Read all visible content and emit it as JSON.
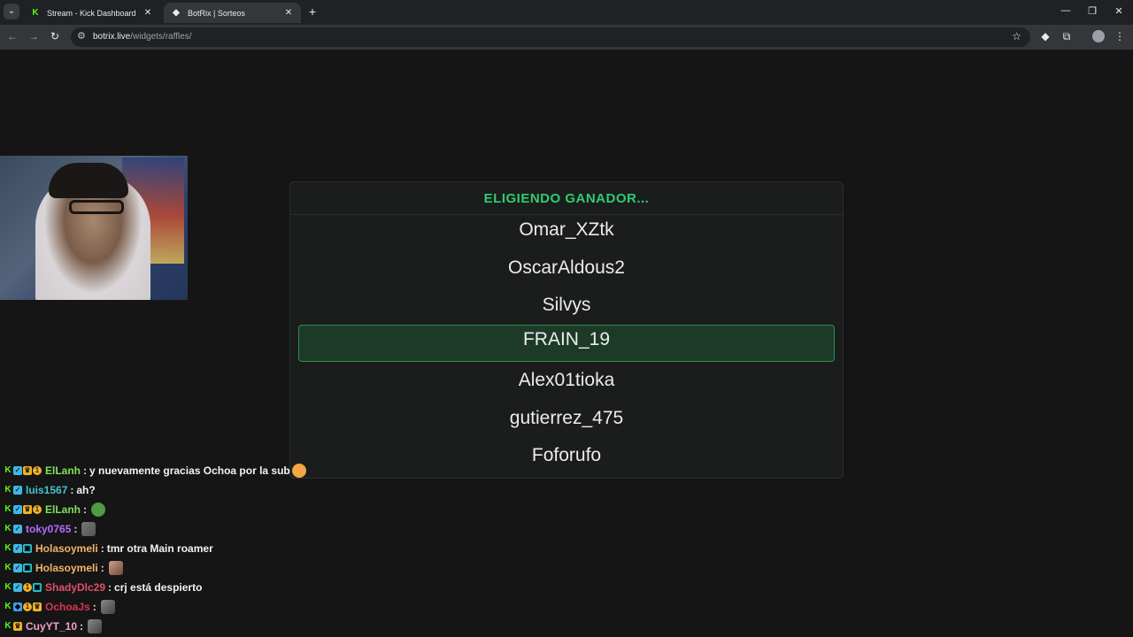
{
  "tabs": [
    {
      "title": "Stream - Kick Dashboard",
      "favicon": "kick-icon"
    },
    {
      "title": "BotRix | Sorteos",
      "favicon": "botrix-icon"
    }
  ],
  "address": {
    "host": "botrix.live",
    "path": "/widgets/raffles/"
  },
  "raffle": {
    "heading": "ELIGIENDO GANADOR...",
    "names": [
      "Omar_XZtk",
      "OscarAldous2",
      "Silvys",
      "FRAIN_19",
      "Alex01tioka",
      "gutierrez_475",
      "Foforufo"
    ],
    "highlighted": "FRAIN_19",
    "accent_color": "#2ecc71"
  },
  "chat": [
    {
      "user": "ElLanh",
      "color": "#7ee05a",
      "message": "y nuevamente gracias Ochoa por la sub",
      "emote": "face",
      "badges": [
        "kick",
        "verified",
        "crown",
        "sub"
      ]
    },
    {
      "user": "luis1567",
      "color": "#40c4d0",
      "message": "ah?",
      "emote": "",
      "badges": [
        "kick",
        "verified"
      ]
    },
    {
      "user": "ElLanh",
      "color": "#7ee05a",
      "message": "",
      "emote": "pepe",
      "badges": [
        "kick",
        "verified",
        "crown",
        "sub"
      ]
    },
    {
      "user": "toky0765",
      "color": "#b56bff",
      "message": "",
      "emote": "img1",
      "badges": [
        "kick",
        "verified"
      ]
    },
    {
      "user": "Holasoymeli",
      "color": "#f2b36b",
      "message": "tmr otra Main roamer",
      "emote": "",
      "badges": [
        "kick",
        "verified",
        "og"
      ]
    },
    {
      "user": "Holasoymeli",
      "color": "#f2b36b",
      "message": "",
      "emote": "img2",
      "badges": [
        "kick",
        "verified",
        "og"
      ]
    },
    {
      "user": "ShadyDlc29",
      "color": "#e0506a",
      "message": "crj está despierto",
      "emote": "",
      "badges": [
        "kick",
        "verified",
        "sub",
        "og"
      ]
    },
    {
      "user": "OchoaJs",
      "color": "#d9364f",
      "message": "",
      "emote": "img3",
      "badges": [
        "kick",
        "cube",
        "sub",
        "crown"
      ]
    },
    {
      "user": "CuyYT_10",
      "color": "#f0a0c8",
      "message": "",
      "emote": "img3",
      "badges": [
        "kick",
        "crown"
      ]
    }
  ]
}
